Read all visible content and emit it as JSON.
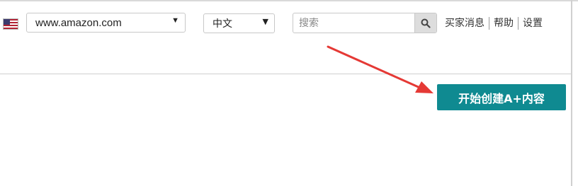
{
  "header": {
    "flag_icon": "us-flag-icon",
    "marketplace": {
      "selected": "www.amazon.com"
    },
    "language": {
      "selected": "中文"
    },
    "search": {
      "placeholder": "搜索",
      "value": "",
      "icon": "search-icon"
    },
    "links": [
      "买家消息",
      "帮助",
      "设置"
    ]
  },
  "main": {
    "cta_label": "开始创建A+内容",
    "cta_color": "#0f8a91",
    "arrow_color": "#e53935"
  }
}
